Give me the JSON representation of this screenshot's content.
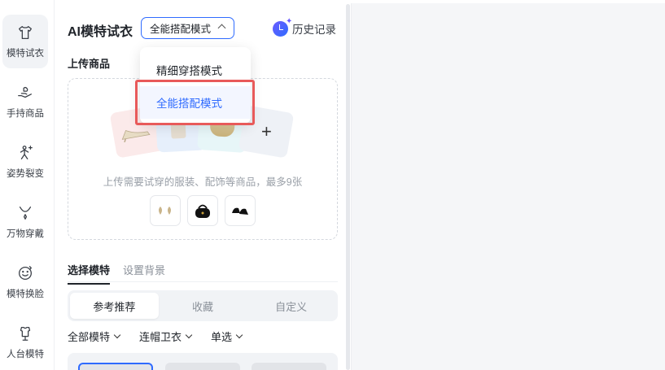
{
  "rail": {
    "items": [
      {
        "label": "模特试衣",
        "icon": "shirt-icon",
        "active": true
      },
      {
        "label": "手持商品",
        "icon": "hand-holding-icon"
      },
      {
        "label": "姿势裂变",
        "icon": "pose-icon"
      },
      {
        "label": "万物穿戴",
        "icon": "necklace-icon"
      },
      {
        "label": "模特换脸",
        "icon": "face-swap-icon"
      },
      {
        "label": "人台模特",
        "icon": "mannequin-icon"
      }
    ]
  },
  "header": {
    "title": "AI模特试衣",
    "mode_value": "全能搭配模式",
    "history_label": "历史记录"
  },
  "upload": {
    "section_label": "上传商品",
    "hint": "上传需要试穿的服装、配饰等商品，最多9张",
    "add_symbol": "+"
  },
  "dropdown": {
    "options": [
      "精细穿搭模式",
      "全能搭配模式"
    ],
    "selected": "全能搭配模式"
  },
  "model_tabs": [
    "选择模特",
    "设置背景"
  ],
  "segments": [
    "参考推荐",
    "收藏",
    "自定义"
  ],
  "filters": [
    "全部模特",
    "连帽卫衣",
    "单选"
  ],
  "colors": {
    "accent": "#2f6bff",
    "highlight_box": "#e85a5a"
  }
}
